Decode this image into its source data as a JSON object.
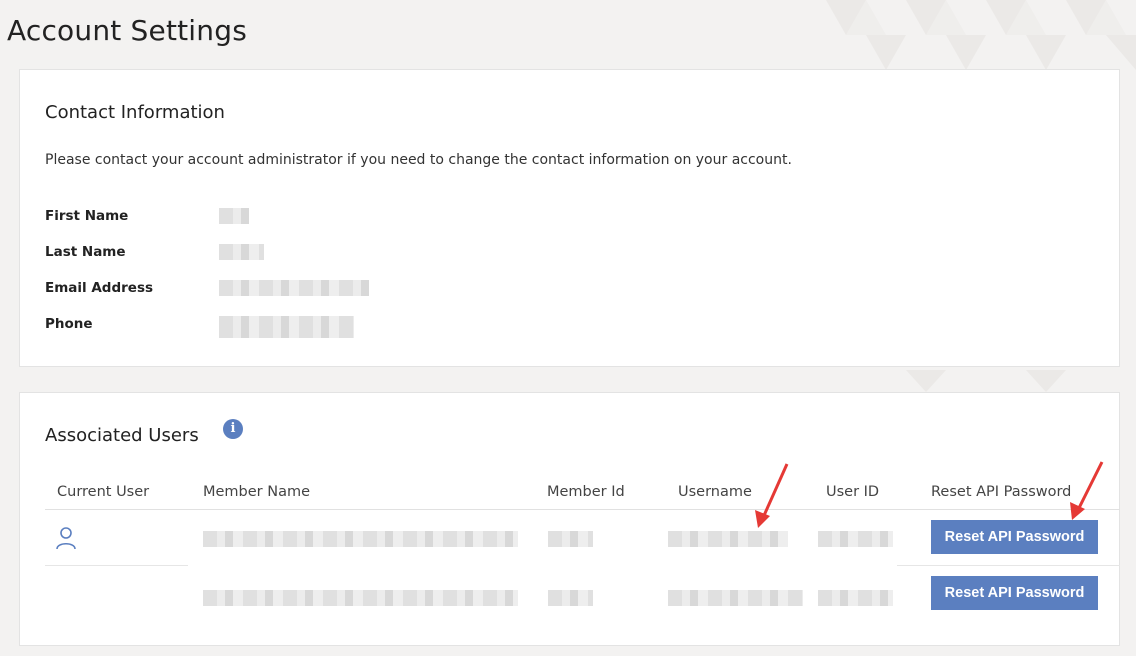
{
  "page": {
    "title": "Account Settings"
  },
  "contact": {
    "title": "Contact Information",
    "note": "Please contact your account administrator if you need to change the contact information on your account.",
    "fields": [
      {
        "label": "First Name"
      },
      {
        "label": "Last Name"
      },
      {
        "label": "Email Address"
      },
      {
        "label": "Phone"
      }
    ]
  },
  "users": {
    "title": "Associated Users",
    "info_icon": "i",
    "columns": [
      "Current User",
      "Member Name",
      "Member Id",
      "Username",
      "User ID",
      "Reset API Password"
    ],
    "rows": [
      {
        "current_user_icon": "person-icon",
        "reset_label": "Reset API Password"
      },
      {
        "reset_label": "Reset API Password"
      }
    ]
  },
  "colors": {
    "accent": "#5b7fc0",
    "arrow": "#e53935",
    "background": "#f3f2f1"
  }
}
